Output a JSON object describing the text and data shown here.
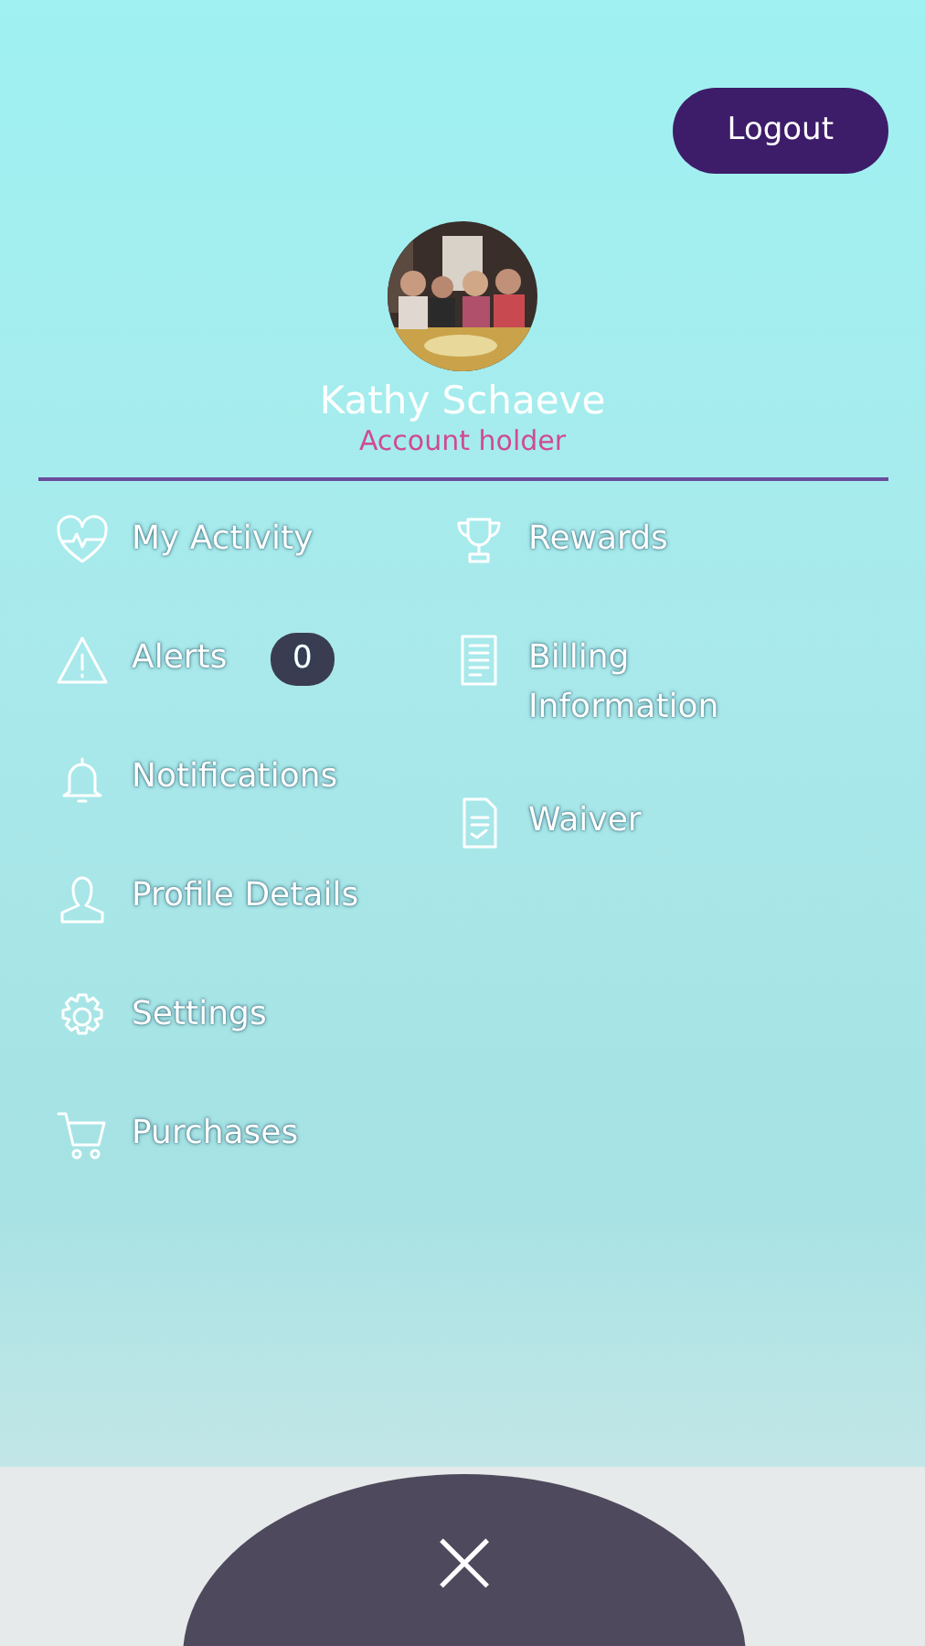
{
  "logout_button": "Logout",
  "profile": {
    "name": "Kathy Schaeve",
    "role": "Account holder"
  },
  "menu": {
    "left": [
      {
        "label": "My Activity"
      },
      {
        "label": "Alerts",
        "badge": "0"
      },
      {
        "label": "Notifications"
      },
      {
        "label": "Profile Details"
      },
      {
        "label": "Settings"
      },
      {
        "label": "Purchases"
      }
    ],
    "right": [
      {
        "label": "Rewards"
      },
      {
        "label": "Billing Information"
      },
      {
        "label": "Waiver"
      }
    ]
  },
  "close_button": "×"
}
